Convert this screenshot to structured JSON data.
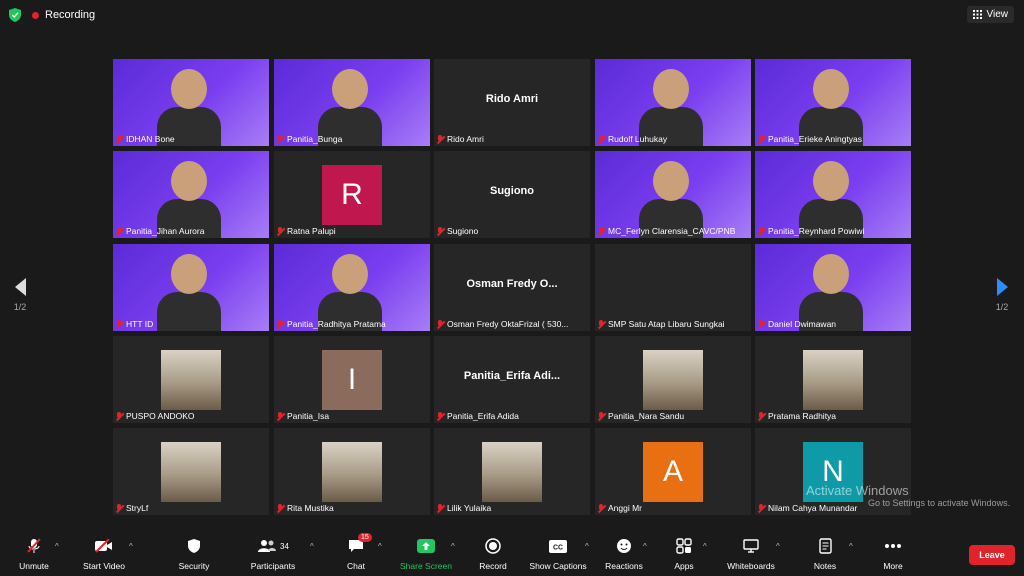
{
  "topbar": {
    "recording_label": "Recording",
    "view_label": "View"
  },
  "pagination": {
    "left": "1/2",
    "right": "1/2"
  },
  "tiles": [
    {
      "name": "IDHAN Bone",
      "kind": "video"
    },
    {
      "name": "Panitia_Bunga",
      "kind": "video"
    },
    {
      "name": "Rido Amri",
      "kind": "name",
      "display": "Rido Amri"
    },
    {
      "name": "Rudolf Luhukay",
      "kind": "video"
    },
    {
      "name": "Panitia_Erieke Aningtyas",
      "kind": "video"
    },
    {
      "name": "Panitia_Jihan Aurora",
      "kind": "video"
    },
    {
      "name": "Ratna Palupi",
      "kind": "avatar",
      "letter": "R",
      "color": "#c0174f"
    },
    {
      "name": "Sugiono",
      "kind": "name",
      "display": "Sugiono"
    },
    {
      "name": "MC_Ferlyn Clarensia_CAVC/PNB",
      "kind": "video",
      "speaking": true
    },
    {
      "name": "Panitia_Reynhard Powiwi",
      "kind": "video"
    },
    {
      "name": "HTT ID",
      "kind": "video"
    },
    {
      "name": "Panitia_Radhitya Pratama",
      "kind": "video"
    },
    {
      "name": "Osman Fredy OktaFrizal ( 530...",
      "kind": "name",
      "display": "Osman  Fredy  O..."
    },
    {
      "name": "SMP Satu Atap Libaru Sungkai",
      "kind": "blank"
    },
    {
      "name": "Daniel Dwimawan",
      "kind": "video"
    },
    {
      "name": "PUSPO ANDOKO",
      "kind": "photo"
    },
    {
      "name": "Panitia_Isa",
      "kind": "avatar",
      "letter": "I",
      "color": "#8b6b5c"
    },
    {
      "name": "Panitia_Erifa Adida",
      "kind": "name",
      "display": "Panitia_Erifa  Adi..."
    },
    {
      "name": "Panitia_Nara Sandu",
      "kind": "photo"
    },
    {
      "name": "Pratama Radhitya",
      "kind": "photo"
    },
    {
      "name": "StryLf",
      "kind": "photo"
    },
    {
      "name": "Rita Mustika",
      "kind": "photo"
    },
    {
      "name": "Lilik Yulaika",
      "kind": "photo"
    },
    {
      "name": "Anggi Mr",
      "kind": "avatar",
      "letter": "A",
      "color": "#e86f12"
    },
    {
      "name": "Nilam Cahya Munandar",
      "kind": "avatar",
      "letter": "N",
      "color": "#0f9aa8"
    }
  ],
  "watermark": {
    "title": "Activate Windows",
    "subtitle": "Go to Settings to activate Windows."
  },
  "toolbar": {
    "unmute": "Unmute",
    "start_video": "Start Video",
    "security": "Security",
    "participants": "Participants",
    "participants_count": "34",
    "chat": "Chat",
    "chat_badge": "15",
    "share_screen": "Share Screen",
    "record": "Record",
    "show_captions": "Show Captions",
    "reactions": "Reactions",
    "apps": "Apps",
    "whiteboards": "Whiteboards",
    "notes": "Notes",
    "more": "More",
    "leave": "Leave"
  }
}
